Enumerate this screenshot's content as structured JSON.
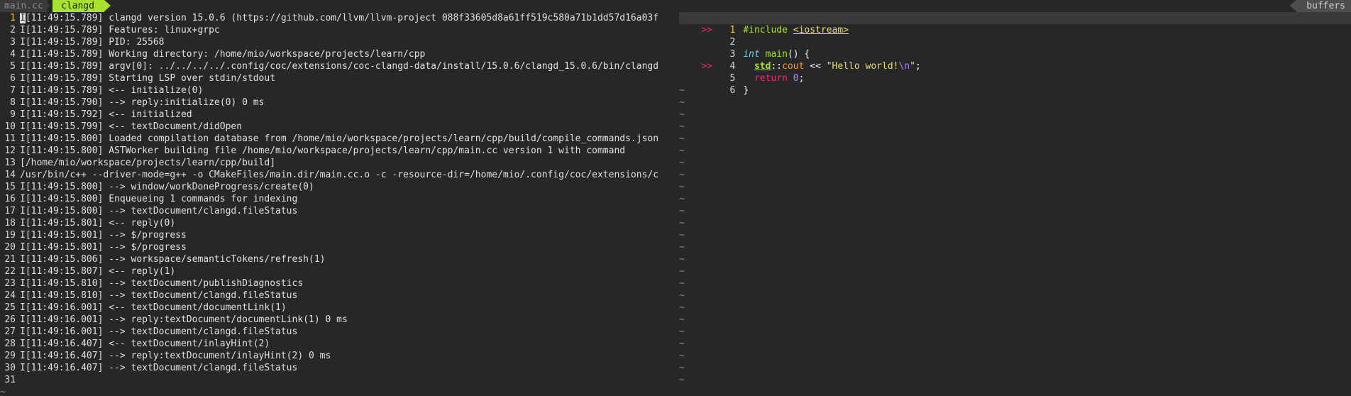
{
  "tabs": {
    "inactive_label": "main.cc",
    "active_label": "clangd",
    "buffers_label": "buffers"
  },
  "log": {
    "lines": [
      {
        "n": "1",
        "text": "I[11:49:15.789] clangd version 15.0.6 (https://github.com/llvm/llvm-project 088f33605d8a61ff519c580a71b1dd57d16a03f"
      },
      {
        "n": "2",
        "text": "I[11:49:15.789] Features: linux+grpc"
      },
      {
        "n": "3",
        "text": "I[11:49:15.789] PID: 25568"
      },
      {
        "n": "4",
        "text": "I[11:49:15.789] Working directory: /home/mio/workspace/projects/learn/cpp"
      },
      {
        "n": "5",
        "text": "I[11:49:15.789] argv[0]: ../../../../.config/coc/extensions/coc-clangd-data/install/15.0.6/clangd_15.0.6/bin/clangd"
      },
      {
        "n": "6",
        "text": "I[11:49:15.789] Starting LSP over stdin/stdout"
      },
      {
        "n": "7",
        "text": "I[11:49:15.789] <-- initialize(0)"
      },
      {
        "n": "8",
        "text": "I[11:49:15.790] --> reply:initialize(0) 0 ms"
      },
      {
        "n": "9",
        "text": "I[11:49:15.792] <-- initialized"
      },
      {
        "n": "10",
        "text": "I[11:49:15.799] <-- textDocument/didOpen"
      },
      {
        "n": "11",
        "text": "I[11:49:15.800] Loaded compilation database from /home/mio/workspace/projects/learn/cpp/build/compile_commands.json"
      },
      {
        "n": "12",
        "text": "I[11:49:15.800] ASTWorker building file /home/mio/workspace/projects/learn/cpp/main.cc version 1 with command"
      },
      {
        "n": "13",
        "text": "[/home/mio/workspace/projects/learn/cpp/build]"
      },
      {
        "n": "14",
        "text": "/usr/bin/c++ --driver-mode=g++ -o CMakeFiles/main.dir/main.cc.o -c -resource-dir=/home/mio/.config/coc/extensions/c"
      },
      {
        "n": "15",
        "text": "I[11:49:15.800] --> window/workDoneProgress/create(0)"
      },
      {
        "n": "16",
        "text": "I[11:49:15.800] Enqueueing 1 commands for indexing"
      },
      {
        "n": "17",
        "text": "I[11:49:15.800] --> textDocument/clangd.fileStatus"
      },
      {
        "n": "18",
        "text": "I[11:49:15.801] <-- reply(0)"
      },
      {
        "n": "19",
        "text": "I[11:49:15.801] --> $/progress"
      },
      {
        "n": "20",
        "text": "I[11:49:15.801] --> $/progress"
      },
      {
        "n": "21",
        "text": "I[11:49:15.806] --> workspace/semanticTokens/refresh(1)"
      },
      {
        "n": "22",
        "text": "I[11:49:15.807] <-- reply(1)"
      },
      {
        "n": "23",
        "text": "I[11:49:15.810] --> textDocument/publishDiagnostics"
      },
      {
        "n": "24",
        "text": "I[11:49:15.810] --> textDocument/clangd.fileStatus"
      },
      {
        "n": "25",
        "text": "I[11:49:16.001] <-- textDocument/documentLink(1)"
      },
      {
        "n": "26",
        "text": "I[11:49:16.001] --> reply:textDocument/documentLink(1) 0 ms"
      },
      {
        "n": "27",
        "text": "I[11:49:16.001] --> textDocument/clangd.fileStatus"
      },
      {
        "n": "28",
        "text": "I[11:49:16.407] <-- textDocument/inlayHint(2)"
      },
      {
        "n": "29",
        "text": "I[11:49:16.407] --> reply:textDocument/inlayHint(2) 0 ms"
      },
      {
        "n": "30",
        "text": "I[11:49:16.407] --> textDocument/clangd.fileStatus"
      },
      {
        "n": "31",
        "text": ""
      }
    ],
    "first_char": "I",
    "first_rest": "[11:49:15.789] clangd version 15.0.6 (https://github.com/llvm/llvm-project 088f33605d8a61ff519c580a71b1dd57d16a03f",
    "eob": "~"
  },
  "code": {
    "sign": ">>",
    "include_kw": "#include",
    "include_hdr": "<iostream>",
    "int_kw": "int",
    "main_fn": "main",
    "main_rest": "() {",
    "std_ns": "std",
    "scope_op": "::",
    "cout_id": "cout",
    "shift_op": " << ",
    "str_open": "\"Hello world!",
    "str_esc": "\\n",
    "str_close": "\"",
    "semi": ";",
    "return_kw": "return",
    "zero": "0",
    "close_brace": "}",
    "eob": "~",
    "line_numbers": [
      "1",
      "2",
      "3",
      "4",
      "5",
      "6"
    ]
  }
}
